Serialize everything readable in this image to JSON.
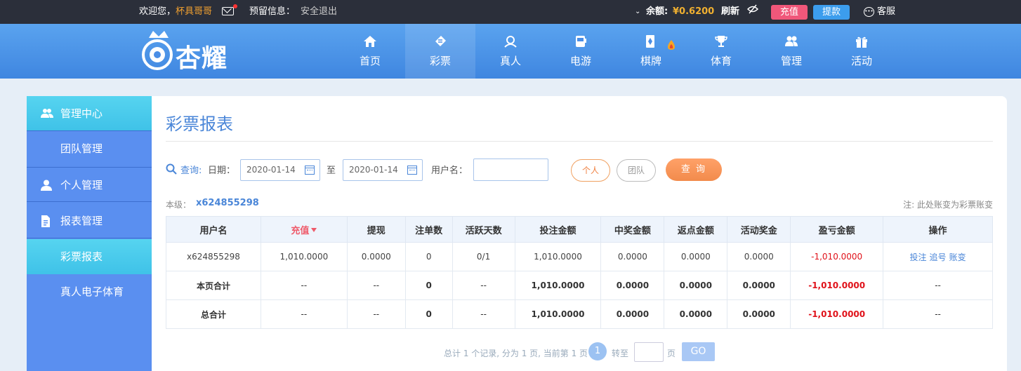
{
  "topbar": {
    "welcome": "欢迎您，",
    "username": "杯具哥哥",
    "reserved_info": "预留信息：",
    "logout": "安全退出",
    "balance_label": "余额:",
    "balance_value": "¥0.6200",
    "refresh": "刷新",
    "recharge": "充值",
    "withdraw": "提款",
    "customer_service": "客服"
  },
  "header": {
    "logo_text": "杏耀",
    "nav": [
      {
        "label": "首页",
        "icon": "home-icon"
      },
      {
        "label": "彩票",
        "icon": "lottery-icon"
      },
      {
        "label": "真人",
        "icon": "live-icon"
      },
      {
        "label": "电游",
        "icon": "slot-icon"
      },
      {
        "label": "棋牌",
        "icon": "cards-icon"
      },
      {
        "label": "体育",
        "icon": "trophy-icon"
      },
      {
        "label": "管理",
        "icon": "manage-icon"
      },
      {
        "label": "活动",
        "icon": "gift-icon"
      }
    ],
    "active_nav": "彩票"
  },
  "sidebar": {
    "items": [
      {
        "label": "管理中心",
        "type": "main",
        "icon": "group-icon"
      },
      {
        "label": "团队管理",
        "type": "sub"
      },
      {
        "label": "个人管理",
        "type": "main",
        "icon": "person-icon"
      },
      {
        "label": "报表管理",
        "type": "main",
        "icon": "report-icon"
      },
      {
        "label": "彩票报表",
        "type": "sub"
      },
      {
        "label": "真人电子体育",
        "type": "sub"
      }
    ],
    "active_items": [
      "管理中心",
      "彩票报表"
    ]
  },
  "main": {
    "title": "彩票报表",
    "query": {
      "label": "查询:",
      "date_label": "日期：",
      "date_from": "2020-01-14",
      "to_label": "至",
      "date_to": "2020-01-14",
      "username_label": "用户名：",
      "username_value": "",
      "personal": "个人",
      "team": "团队",
      "submit": "查 询"
    },
    "level_label": "本级：",
    "level_value": "x624855298",
    "note": "注: 此处账变为彩票账变",
    "table": {
      "columns": [
        "用户名",
        "充值",
        "提现",
        "注单数",
        "活跃天数",
        "投注金额",
        "中奖金额",
        "返点金额",
        "活动奖金",
        "盈亏金额",
        "操作"
      ],
      "sort_column": "充值",
      "rows": [
        {
          "cells": [
            "x624855298",
            "1,010.0000",
            "0.0000",
            "0",
            "0/1",
            "1,010.0000",
            "0.0000",
            "0.0000",
            "0.0000",
            "-1,010.0000"
          ],
          "actions": [
            "投注",
            "追号",
            "账变"
          ]
        }
      ],
      "page_total": {
        "cells": [
          "本页合计",
          "--",
          "--",
          "0",
          "--",
          "1,010.0000",
          "0.0000",
          "0.0000",
          "0.0000",
          "-1,010.0000",
          "--"
        ]
      },
      "grand_total": {
        "cells": [
          "总合计",
          "--",
          "--",
          "0",
          "--",
          "1,010.0000",
          "0.0000",
          "0.0000",
          "0.0000",
          "-1,010.0000",
          "--"
        ]
      }
    },
    "pager": {
      "summary": "总计 1 个记录, 分为 1 页, 当前第 1 页",
      "current": "1",
      "goto_label": "转至",
      "page_label": "页",
      "go": "GO"
    }
  },
  "colors": {
    "header_blue": "#4a8ee6",
    "sidebar_blue": "#5a8ff0",
    "active_cyan": "#46c8ec",
    "accent_orange": "#f28b4c",
    "negative_red": "#e0121a"
  }
}
